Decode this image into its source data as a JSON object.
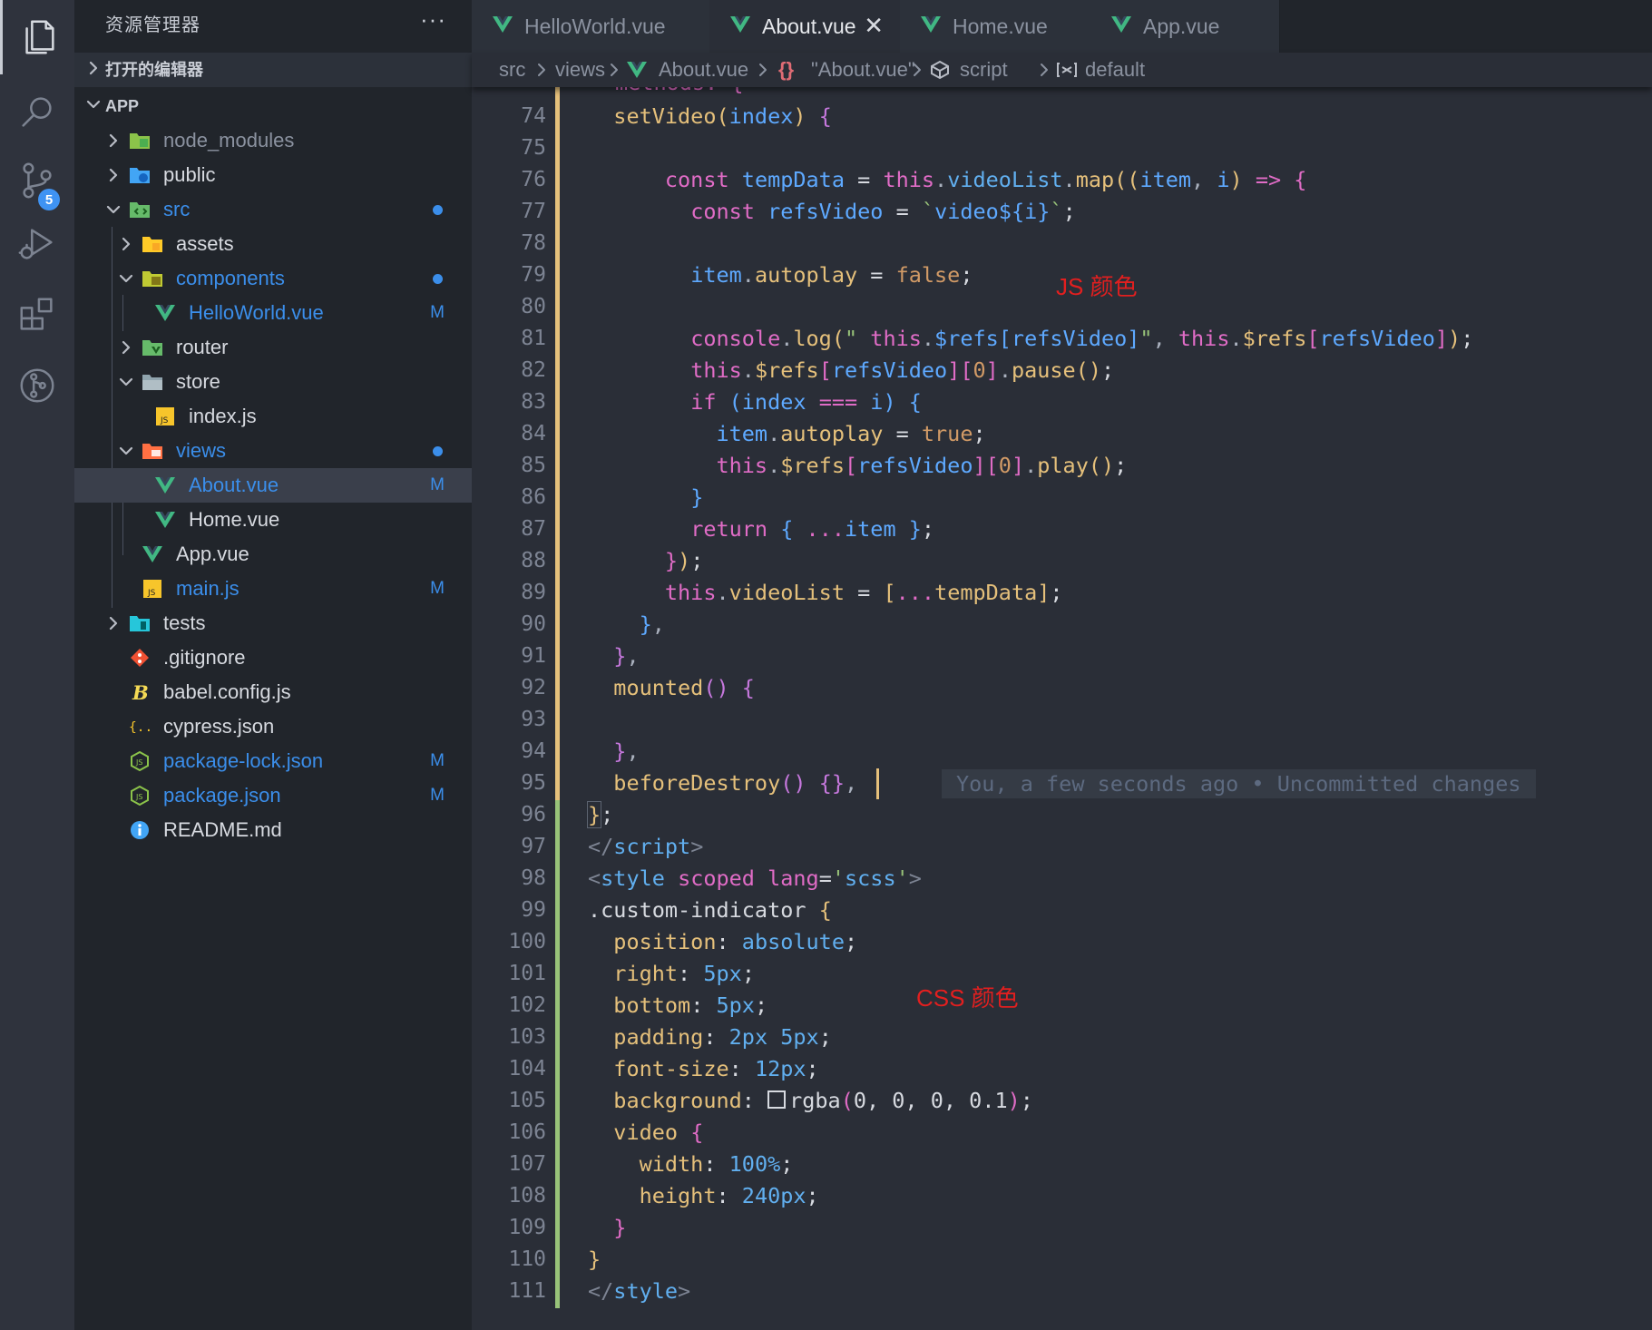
{
  "sidebar": {
    "title": "资源管理器",
    "more": "···",
    "open_editors": "打开的编辑器",
    "app_section": "APP",
    "tree": [
      {
        "name": "node_modules",
        "status": ""
      },
      {
        "name": "public",
        "status": ""
      },
      {
        "name": "src",
        "status": ""
      },
      {
        "name": "assets",
        "status": ""
      },
      {
        "name": "components",
        "status": ""
      },
      {
        "name": "HelloWorld.vue",
        "status": "M"
      },
      {
        "name": "router",
        "status": ""
      },
      {
        "name": "store",
        "status": ""
      },
      {
        "name": "index.js",
        "status": ""
      },
      {
        "name": "views",
        "status": ""
      },
      {
        "name": "About.vue",
        "status": "M"
      },
      {
        "name": "Home.vue",
        "status": ""
      },
      {
        "name": "App.vue",
        "status": ""
      },
      {
        "name": "main.js",
        "status": "M"
      },
      {
        "name": "tests",
        "status": ""
      },
      {
        "name": ".gitignore",
        "status": ""
      },
      {
        "name": "babel.config.js",
        "status": ""
      },
      {
        "name": "cypress.json",
        "status": ""
      },
      {
        "name": "package-lock.json",
        "status": "M"
      },
      {
        "name": "package.json",
        "status": "M"
      },
      {
        "name": "README.md",
        "status": ""
      }
    ]
  },
  "activity": {
    "scm_badge": "5"
  },
  "tabs": [
    {
      "label": "HelloWorld.vue"
    },
    {
      "label": "About.vue",
      "close": "✕"
    },
    {
      "label": "Home.vue"
    },
    {
      "label": "App.vue"
    }
  ],
  "breadcrumb": {
    "items": [
      "src",
      "views",
      "About.vue",
      "{}",
      "\"About.vue\"",
      "script",
      "default"
    ]
  },
  "editor": {
    "line_numbers": [
      "74",
      "75",
      "76",
      "77",
      "78",
      "79",
      "80",
      "81",
      "82",
      "83",
      "84",
      "85",
      "86",
      "87",
      "88",
      "89",
      "90",
      "91",
      "92",
      "93",
      "94",
      "95",
      "96",
      "97",
      "98",
      "99",
      "100",
      "101",
      "102",
      "103",
      "104",
      "105",
      "106",
      "107",
      "108",
      "109",
      "110",
      "111"
    ],
    "top_partial": "methods: {",
    "blame": "You, a few seconds ago • Uncommitted changes",
    "annotation_js": "JS 颜色",
    "annotation_css": "CSS 颜色"
  },
  "colors": {
    "accent": "#3b8eea",
    "editor_bg": "#2a2e37",
    "sidebar_bg": "#21252b",
    "annotation": "#e21f1f",
    "vue_green": "#41b883"
  }
}
